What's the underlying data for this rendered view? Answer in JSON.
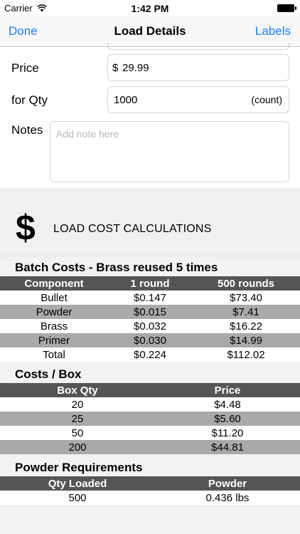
{
  "status_bar": {
    "carrier": "Carrier",
    "time": "1:42 PM"
  },
  "nav": {
    "left": "Done",
    "title": "Load Details",
    "right": "Labels"
  },
  "form": {
    "price_label": "Price",
    "price_currency": "$",
    "price_value": "29.99",
    "qty_label": "for Qty",
    "qty_value": "1000",
    "qty_unit": "(count)",
    "notes_label": "Notes",
    "notes_placeholder": "Add note here"
  },
  "calc": {
    "icon_glyph": "$",
    "title": "LOAD COST CALCULATIONS",
    "batch": {
      "title": "Batch Costs - Brass reused 5 times",
      "headers": [
        "Component",
        "1 round",
        "500 rounds"
      ],
      "rows": [
        [
          "Bullet",
          "$0.147",
          "$73.40"
        ],
        [
          "Powder",
          "$0.015",
          "$7.41"
        ],
        [
          "Brass",
          "$0.032",
          "$16.22"
        ],
        [
          "Primer",
          "$0.030",
          "$14.99"
        ],
        [
          "Total",
          "$0.224",
          "$112.02"
        ]
      ]
    },
    "box": {
      "title": "Costs / Box",
      "headers": [
        "Box Qty",
        "Price"
      ],
      "rows": [
        [
          "20",
          "$4.48"
        ],
        [
          "25",
          "$5.60"
        ],
        [
          "50",
          "$11.20"
        ],
        [
          "200",
          "$44.81"
        ]
      ]
    },
    "powder": {
      "title": "Powder Requirements",
      "headers": [
        "Qty Loaded",
        "Powder"
      ],
      "rows": [
        [
          "500",
          "0.436 lbs"
        ]
      ]
    }
  }
}
